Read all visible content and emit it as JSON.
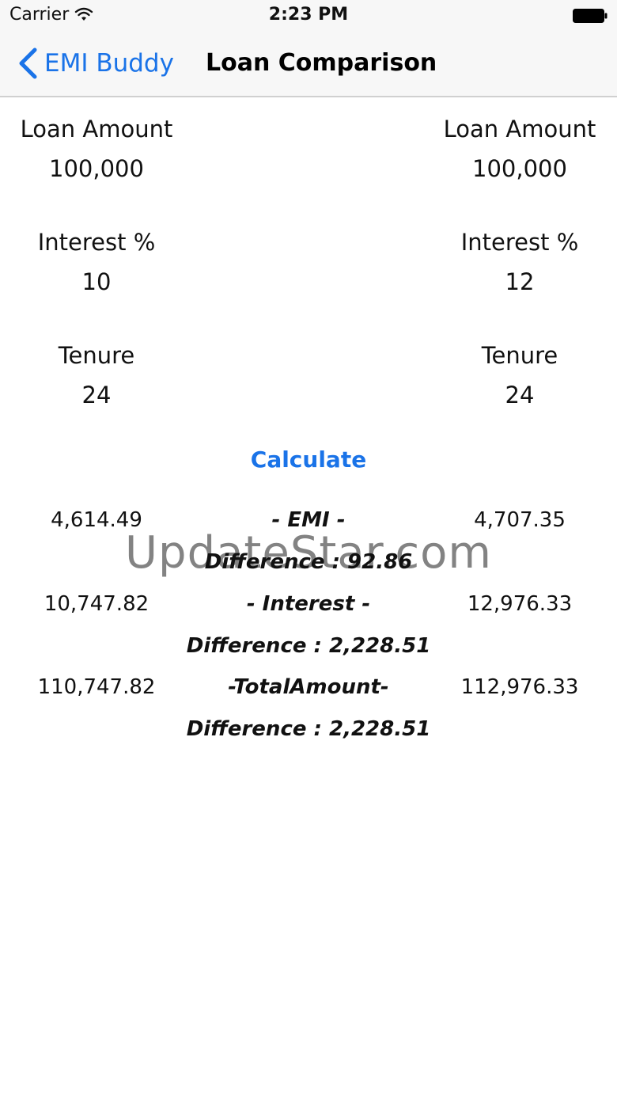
{
  "status_bar": {
    "carrier": "Carrier",
    "time": "2:23 PM",
    "icons": [
      "wifi-icon",
      "battery-icon"
    ]
  },
  "nav": {
    "back_label": "EMI Buddy",
    "title": "Loan Comparison",
    "back_icon": "chevron-left-icon"
  },
  "inputs": {
    "left": {
      "loan_amount_label": "Loan Amount",
      "loan_amount": "100,000",
      "interest_label": "Interest %",
      "interest": "10",
      "tenure_label": "Tenure",
      "tenure": "24"
    },
    "right": {
      "loan_amount_label": "Loan Amount",
      "loan_amount": "100,000",
      "interest_label": "Interest %",
      "interest": "12",
      "tenure_label": "Tenure",
      "tenure": "24"
    }
  },
  "calculate_label": "Calculate",
  "results": {
    "emi": {
      "label": "- EMI -",
      "left": "4,614.49",
      "right": "4,707.35",
      "difference": "Difference :  92.86"
    },
    "interest": {
      "label": "- Interest -",
      "left": "10,747.82",
      "right": "12,976.33",
      "difference": "Difference :  2,228.51"
    },
    "total": {
      "label": "-TotalAmount-",
      "left": "110,747.82",
      "right": "112,976.33",
      "difference": "Difference :  2,228.51"
    }
  },
  "watermark": "UpdateStar.com",
  "colors": {
    "accent": "#1a73e8",
    "bar_background": "#f7f7f7"
  }
}
